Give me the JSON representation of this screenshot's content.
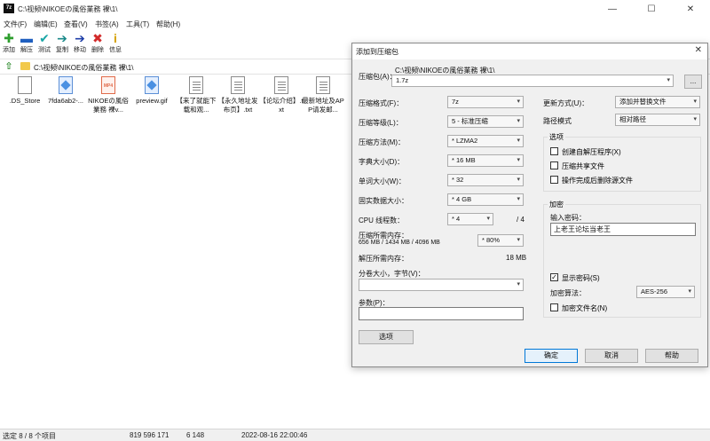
{
  "window": {
    "app_icon_text": "7z",
    "title": "C:\\视频\\NIKOEの風俗業務 裸\\1\\",
    "minimize": "—",
    "maximize": "☐",
    "close": "✕"
  },
  "menu": [
    "文件(F)",
    "编辑(E)",
    "查看(V)",
    "书签(A)",
    "工具(T)",
    "帮助(H)"
  ],
  "toolbar": {
    "buttons": [
      {
        "label": "添加",
        "icon": "plus-icon",
        "glyph": "✚",
        "color": "#2e9e2e"
      },
      {
        "label": "解压",
        "icon": "minus-icon",
        "glyph": "▬",
        "color": "#1f5fbf"
      },
      {
        "label": "测试",
        "icon": "check-icon",
        "glyph": "✔",
        "color": "#1aa6a6"
      },
      {
        "label": "复制",
        "icon": "copy-arrow-icon",
        "glyph": "➔",
        "color": "#1b8a8a"
      },
      {
        "label": "移动",
        "icon": "move-arrow-icon",
        "glyph": "➔",
        "color": "#1f3fa8"
      },
      {
        "label": "删除",
        "icon": "delete-icon",
        "glyph": "✖",
        "color": "#d22a2a"
      },
      {
        "label": "信息",
        "icon": "info-icon",
        "glyph": "i",
        "color": "#d4a000"
      }
    ]
  },
  "address": {
    "up_glyph": "⇧",
    "path": "C:\\视频\\NIKOEの風俗業務 裸\\1\\"
  },
  "files": [
    {
      "name": ".DS_Store",
      "type": "file",
      "badge": ""
    },
    {
      "name": "7fda6ab2-...",
      "type": "img",
      "badge": ""
    },
    {
      "name": "NIKOEの風俗業務 裸v...",
      "type": "mp4",
      "badge": "MP4"
    },
    {
      "name": "preview.gif",
      "type": "img",
      "badge": ""
    },
    {
      "name": "【来了就能下载和观...",
      "type": "txt",
      "badge": ""
    },
    {
      "name": "【永久地址发布页】.txt",
      "type": "txt",
      "badge": ""
    },
    {
      "name": "【论坛介绍】.txt",
      "type": "txt",
      "badge": ""
    },
    {
      "name": "最新地址及APP请发邮...",
      "type": "txt",
      "badge": ""
    }
  ],
  "status": {
    "selection": "选定 8 / 8 个项目",
    "size": "819 596 171",
    "packed": "6 148",
    "modified": "2022-08-16 22:00:46"
  },
  "dialog": {
    "title": "添加到压缩包",
    "close": "✕",
    "archive_label": "压缩包(A)：",
    "archive_dir": "C:\\视频\\NIKOEの風俗業務 裸\\1\\",
    "archive_name": "1.7z",
    "browse_label": "...",
    "format_label": "压缩格式(F)：",
    "format_value": "7z",
    "level_label": "压缩等级(L)：",
    "level_value": "5 - 标准压缩",
    "method_label": "压缩方法(M)：",
    "method_value": "* LZMA2",
    "dict_label": "字典大小(D)：",
    "dict_value": "* 16 MB",
    "word_label": "单词大小(W)：",
    "word_value": "* 32",
    "solid_label": "固实数据大小：",
    "solid_value": "* 4 GB",
    "cpu_label": "CPU 线程数：",
    "cpu_value": "* 4",
    "cpu_total": "/ 4",
    "mem_label": "压缩所需内存：",
    "mem_detail": "656 MB / 1434 MB / 4096 MB",
    "mem_value": "* 80%",
    "decomp_label": "解压所需内存：",
    "decomp_value": "18 MB",
    "split_label": "分卷大小，字节(V)：",
    "split_value": "",
    "params_label": "参数(P)：",
    "params_value": "",
    "options_button": "选项",
    "update_label": "更新方式(U)：",
    "update_value": "添加并替换文件",
    "path_label": "路径模式",
    "path_value": "相对路径",
    "options_group": "选项",
    "opt_sfx": "创建自解压程序(X)",
    "opt_shared": "压缩共享文件",
    "opt_delete": "操作完成后删除源文件",
    "enc_group": "加密",
    "password_label": "输入密码：",
    "password_value": "上老王论坛当老王",
    "show_password": "显示密码(S)",
    "show_password_checked": "✓",
    "enc_method_label": "加密算法：",
    "enc_method_value": "AES-256",
    "encrypt_names": "加密文件名(N)",
    "ok": "确定",
    "cancel": "取消",
    "help": "帮助"
  }
}
